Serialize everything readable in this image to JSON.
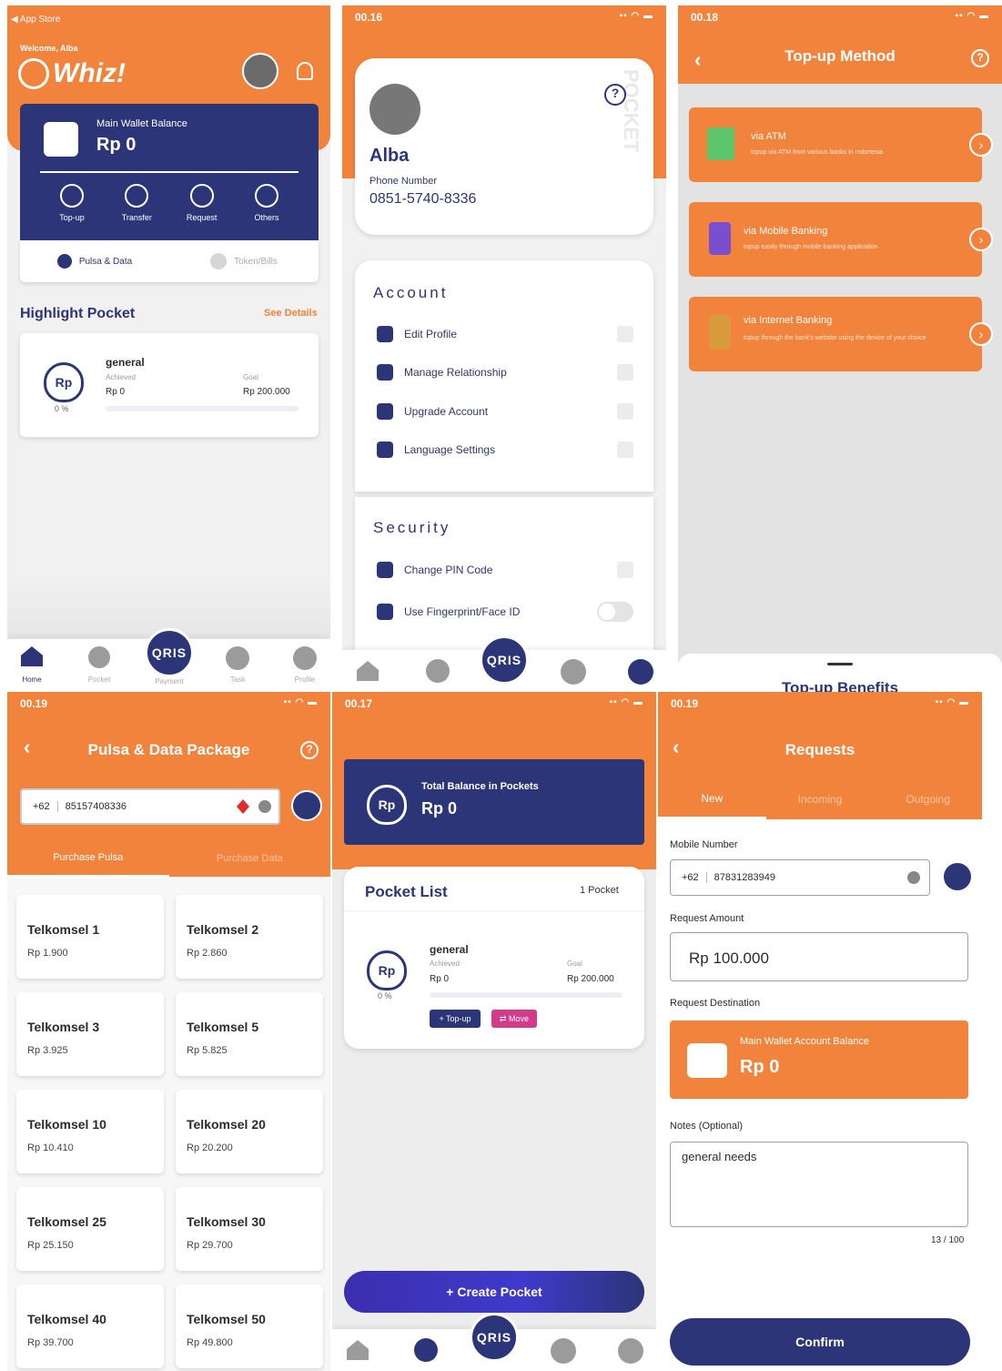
{
  "s1": {
    "back": "◀ App Store",
    "welcome": "Welcome, Alba",
    "brand": "Whiz!",
    "wallet_label": "Main Wallet Balance",
    "wallet_value": "Rp 0",
    "actions": [
      "Top-up",
      "Transfer",
      "Request",
      "Others"
    ],
    "pulsa": "Pulsa & Data",
    "token": "Token/Bills",
    "highlight": "Highlight Pocket",
    "see": "See Details",
    "pocket": {
      "name": "general",
      "achieved_label": "Achieved",
      "achieved": "Rp 0",
      "goal_label": "Goal",
      "goal": "Rp 200.000",
      "pct": "0 %",
      "progress": 0
    },
    "nav": [
      "Home",
      "Pocket",
      "Payment",
      "Task",
      "Profile"
    ],
    "qris": "QRIS"
  },
  "s2": {
    "time": "00.16",
    "name": "Alba",
    "phone_label": "Phone Number",
    "phone": "0851-5740-8336",
    "watermark": "POCKET POCKET",
    "account_title": "Account",
    "account_items": [
      "Edit Profile",
      "Manage Relationship",
      "Upgrade Account",
      "Language Settings"
    ],
    "security_title": "Security",
    "security_items": [
      "Change PIN Code",
      "Use Fingerprint/Face ID"
    ]
  },
  "s3": {
    "time": "00.18",
    "title": "Top-up Method",
    "methods": [
      {
        "title": "via ATM",
        "sub": "topup via ATM from various banks in Indonesia"
      },
      {
        "title": "via Mobile Banking",
        "sub": "topup easily through mobile banking application"
      },
      {
        "title": "via Internet Banking",
        "sub": "topup through the bank's website using the device of your choice"
      }
    ],
    "benefits": "Top-up Benefits"
  },
  "s4": {
    "time": "00.19",
    "title": "Pulsa & Data Package",
    "prefix": "+62",
    "number": "85157408336",
    "tabs": [
      "Purchase Pulsa",
      "Purchase Data"
    ],
    "tiles": [
      {
        "n": "Telkomsel 1",
        "p": "Rp 1.900"
      },
      {
        "n": "Telkomsel 2",
        "p": "Rp 2.860"
      },
      {
        "n": "Telkomsel 3",
        "p": "Rp 3.925"
      },
      {
        "n": "Telkomsel 5",
        "p": "Rp 5.825"
      },
      {
        "n": "Telkomsel 10",
        "p": "Rp 10.410"
      },
      {
        "n": "Telkomsel 20",
        "p": "Rp 20.200"
      },
      {
        "n": "Telkomsel 25",
        "p": "Rp 25.150"
      },
      {
        "n": "Telkomsel 30",
        "p": "Rp 29.700"
      },
      {
        "n": "Telkomsel 40",
        "p": "Rp 39.700"
      },
      {
        "n": "Telkomsel 50",
        "p": "Rp 49.800"
      }
    ]
  },
  "s5": {
    "time": "00.17",
    "total_label": "Total Balance in Pockets",
    "total_value": "Rp 0",
    "list_title": "Pocket List",
    "count": "1 Pocket",
    "pocket": {
      "name": "general",
      "achieved_label": "Achieved",
      "achieved": "Rp 0",
      "goal_label": "Goal",
      "goal": "Rp 200.000",
      "pct": "0 %",
      "progress": 0
    },
    "topup": "+ Top-up",
    "move": "⇄ Move",
    "create": "+  Create Pocket"
  },
  "s6": {
    "time": "00.19",
    "title": "Requests",
    "tabs": [
      "New",
      "Incoming",
      "Outgoing"
    ],
    "mobile_label": "Mobile Number",
    "prefix": "+62",
    "number": "87831283949",
    "amount_label": "Request Amount",
    "amount": "Rp 100.000",
    "dest_label": "Request Destination",
    "dest_title": "Main Wallet Account Balance",
    "dest_value": "Rp 0",
    "notes_label": "Notes (Optional)",
    "notes": "general needs",
    "count": "13 / 100",
    "confirm": "Confirm"
  },
  "colors": {
    "orange": "#f2833c",
    "navy": "#2c3577",
    "magenta": "#d23a8a"
  }
}
